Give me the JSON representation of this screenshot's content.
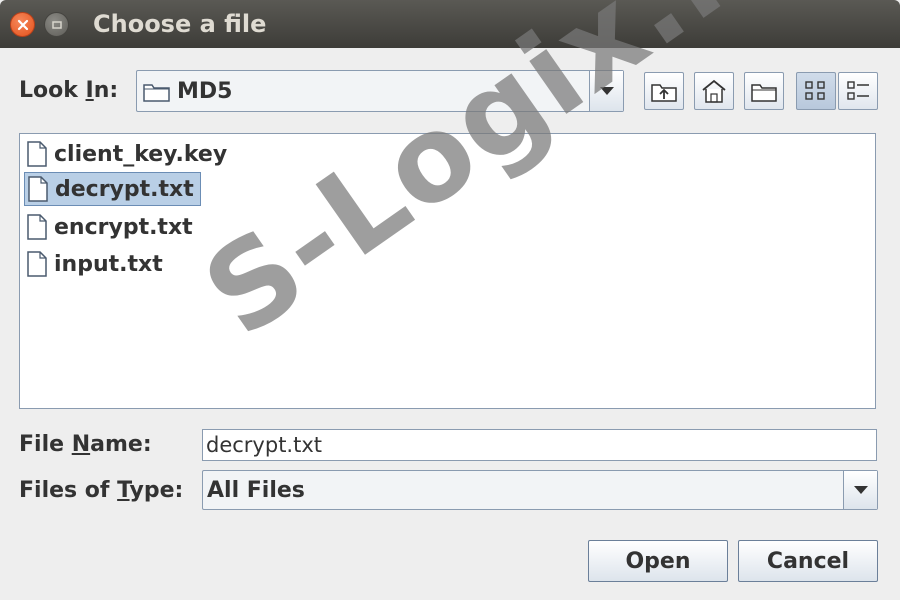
{
  "window": {
    "title": "Choose a file"
  },
  "look_in": {
    "label_pre": "Look ",
    "label_mnemonic": "I",
    "label_post": "n:",
    "value": "MD5",
    "toolbar": [
      "up-one-level-icon",
      "home-icon",
      "new-folder-icon",
      "list-view-icon",
      "details-view-icon"
    ]
  },
  "files": [
    {
      "name": "client_key.key",
      "selected": false
    },
    {
      "name": "decrypt.txt",
      "selected": true
    },
    {
      "name": "encrypt.txt",
      "selected": false
    },
    {
      "name": "input.txt",
      "selected": false
    }
  ],
  "file_name": {
    "label_pre": "File ",
    "label_mnemonic": "N",
    "label_post": "ame:",
    "value": "decrypt.txt"
  },
  "file_type": {
    "label_pre": "Files of ",
    "label_mnemonic": "T",
    "label_post": "ype:",
    "value": "All Files"
  },
  "buttons": {
    "open": "Open",
    "cancel": "Cancel"
  },
  "watermark": "S-Logix.in"
}
